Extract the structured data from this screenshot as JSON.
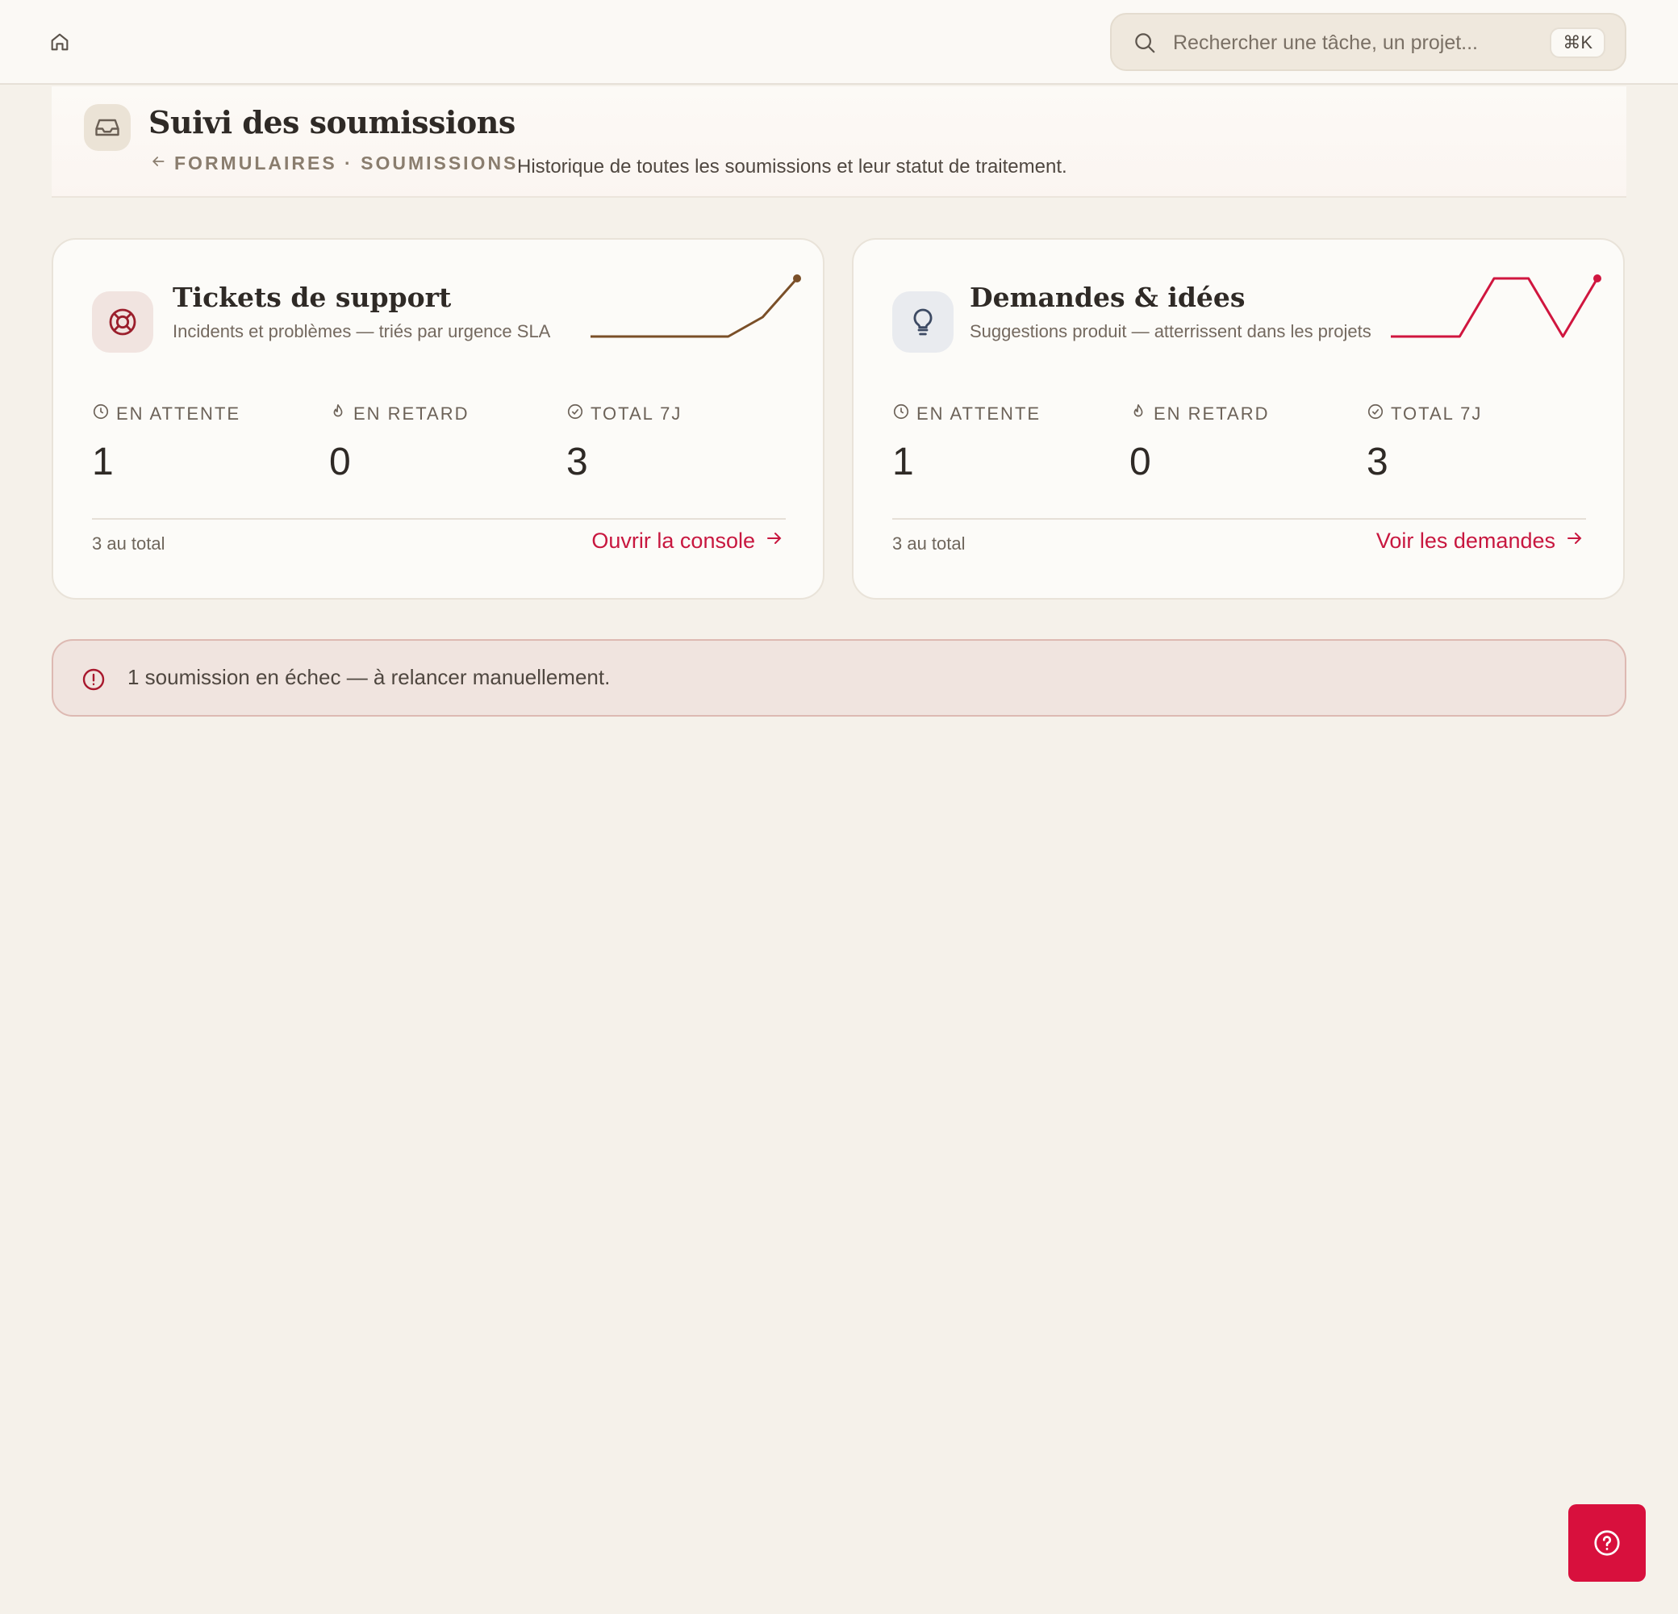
{
  "topbar": {
    "home_icon": "home-icon",
    "search": {
      "placeholder": "Rechercher une tâche, un projet...",
      "shortcut": "⌘K",
      "icon": "search-icon"
    }
  },
  "header": {
    "icon": "inbox-icon",
    "title": "Suivi des soumissions",
    "breadcrumb": "FORMULAIRES · SOUMISSIONS",
    "description": "Historique de toutes les soumissions et leur statut de traitement."
  },
  "cards": [
    {
      "icon": "lifebuoy-icon",
      "title": "Tickets de support",
      "subtitle": "Incidents et problèmes — triés par urgence SLA",
      "stats": [
        {
          "icon": "clock-icon",
          "label": "EN ATTENTE",
          "value": "1"
        },
        {
          "icon": "flame-icon",
          "label": "EN RETARD",
          "value": "0"
        },
        {
          "icon": "check-circle-icon",
          "label": "TOTAL 7J",
          "value": "3"
        }
      ],
      "total_note": "3 au total",
      "link_label": "Ouvrir la console",
      "sparkline": [
        0,
        0,
        0,
        0,
        0,
        1,
        3
      ],
      "color": "#7a4f28"
    },
    {
      "icon": "lightbulb-icon",
      "title": "Demandes & idées",
      "subtitle": "Suggestions produit — atterrissent dans les projets",
      "stats": [
        {
          "icon": "clock-icon",
          "label": "EN ATTENTE",
          "value": "1"
        },
        {
          "icon": "flame-icon",
          "label": "EN RETARD",
          "value": "0"
        },
        {
          "icon": "check-circle-icon",
          "label": "TOTAL 7J",
          "value": "3"
        }
      ],
      "total_note": "3 au total",
      "link_label": "Voir les demandes",
      "sparkline": [
        0,
        0,
        0,
        3,
        3,
        0,
        3
      ],
      "color": "#d0163f"
    }
  ],
  "alert": {
    "icon": "alert-circle-icon",
    "text": "1 soumission en échec — à relancer manuellement."
  },
  "help": {
    "icon": "help-circle-icon"
  },
  "colors": {
    "accent": "#c8173f",
    "background": "#f5f1ea"
  }
}
